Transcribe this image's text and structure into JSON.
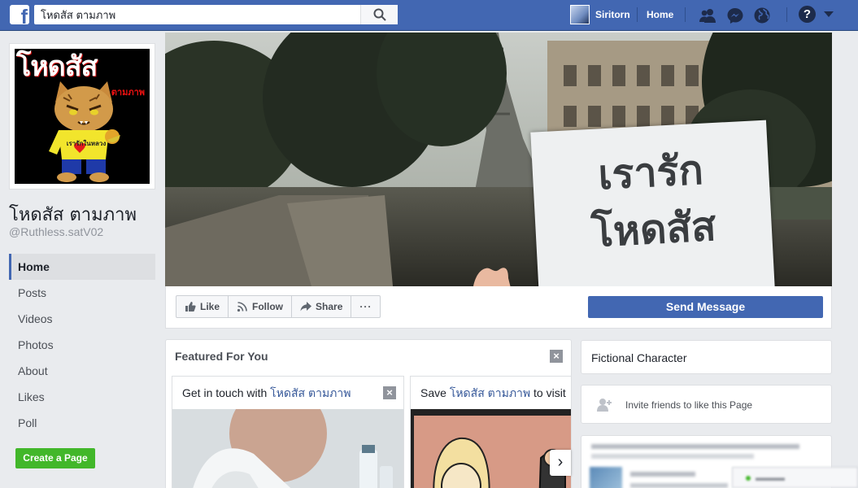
{
  "topbar": {
    "search_value": "โหดสัส ตามภาพ",
    "user_name": "Siritorn",
    "home_label": "Home"
  },
  "profile": {
    "image_title": "โหดสัส",
    "image_subtitle": "ตามภาพ",
    "shirt_text": "เรารักในหลวง",
    "page_name": "โหดสัส ตามภาพ",
    "page_handle": "@Ruthless.satV02"
  },
  "nav": {
    "items": [
      {
        "label": "Home"
      },
      {
        "label": "Posts"
      },
      {
        "label": "Videos"
      },
      {
        "label": "Photos"
      },
      {
        "label": "About"
      },
      {
        "label": "Likes"
      },
      {
        "label": "Poll"
      }
    ],
    "create_page_label": "Create a Page"
  },
  "cover": {
    "sign_line1": "เรารัก",
    "sign_line2": "โหดสัส"
  },
  "actions": {
    "like_label": "Like",
    "follow_label": "Follow",
    "share_label": "Share",
    "more_label": "···",
    "send_message_label": "Send Message"
  },
  "featured": {
    "title": "Featured For You",
    "cards": [
      {
        "prefix": "Get in touch with ",
        "page": "โหดสัส ตามภาพ",
        "suffix": ""
      },
      {
        "prefix": "Save ",
        "page": "โหดสัส ตามภาพ",
        "suffix": " to visit"
      }
    ]
  },
  "sidebar": {
    "category": "Fictional Character",
    "invite_label": "Invite friends to like this Page"
  },
  "colors": {
    "brand": "#4267b2",
    "create_button": "#42b72a",
    "link": "#365899"
  }
}
